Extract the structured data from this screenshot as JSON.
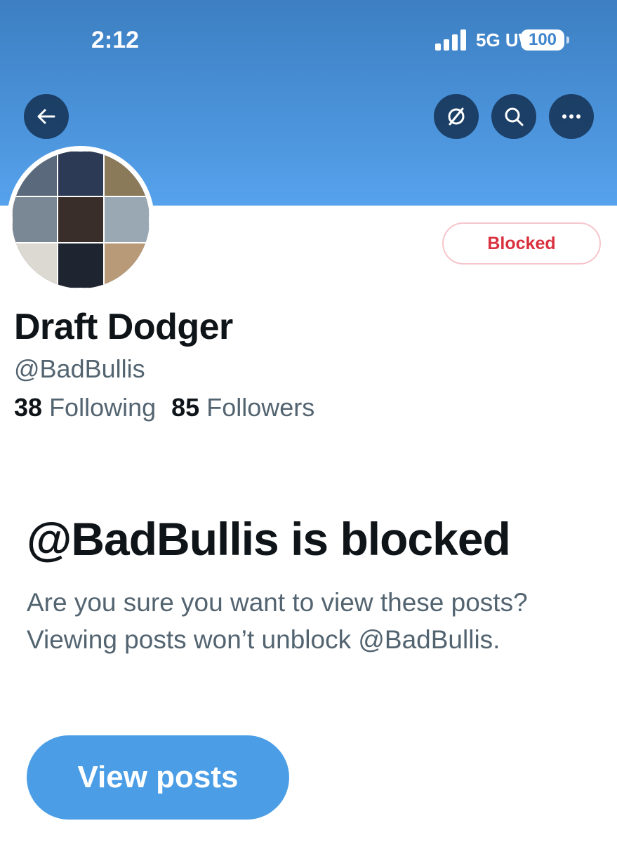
{
  "status_bar": {
    "time": "2:12",
    "network": "5G UW",
    "battery": "100"
  },
  "header": {
    "icons": {
      "back": "arrow-left-icon",
      "unfollow": "slashed-circle-icon",
      "search": "search-icon",
      "more": "more-dots-icon"
    },
    "banner_color": "#4a92d9"
  },
  "profile": {
    "blocked_label": "Blocked",
    "display_name": "Draft Dodger",
    "handle": "@BadBullis",
    "following_count": "38",
    "following_label": "Following",
    "followers_count": "85",
    "followers_label": "Followers"
  },
  "blocked_notice": {
    "title": "@BadBullis is blocked",
    "description": "Are you sure you want to view these posts? Viewing posts won’t unblock @BadBullis.",
    "button_label": "View posts"
  },
  "colors": {
    "accent": "#4b9ee6",
    "blocked_red": "#d9303e",
    "muted_text": "#536471"
  }
}
